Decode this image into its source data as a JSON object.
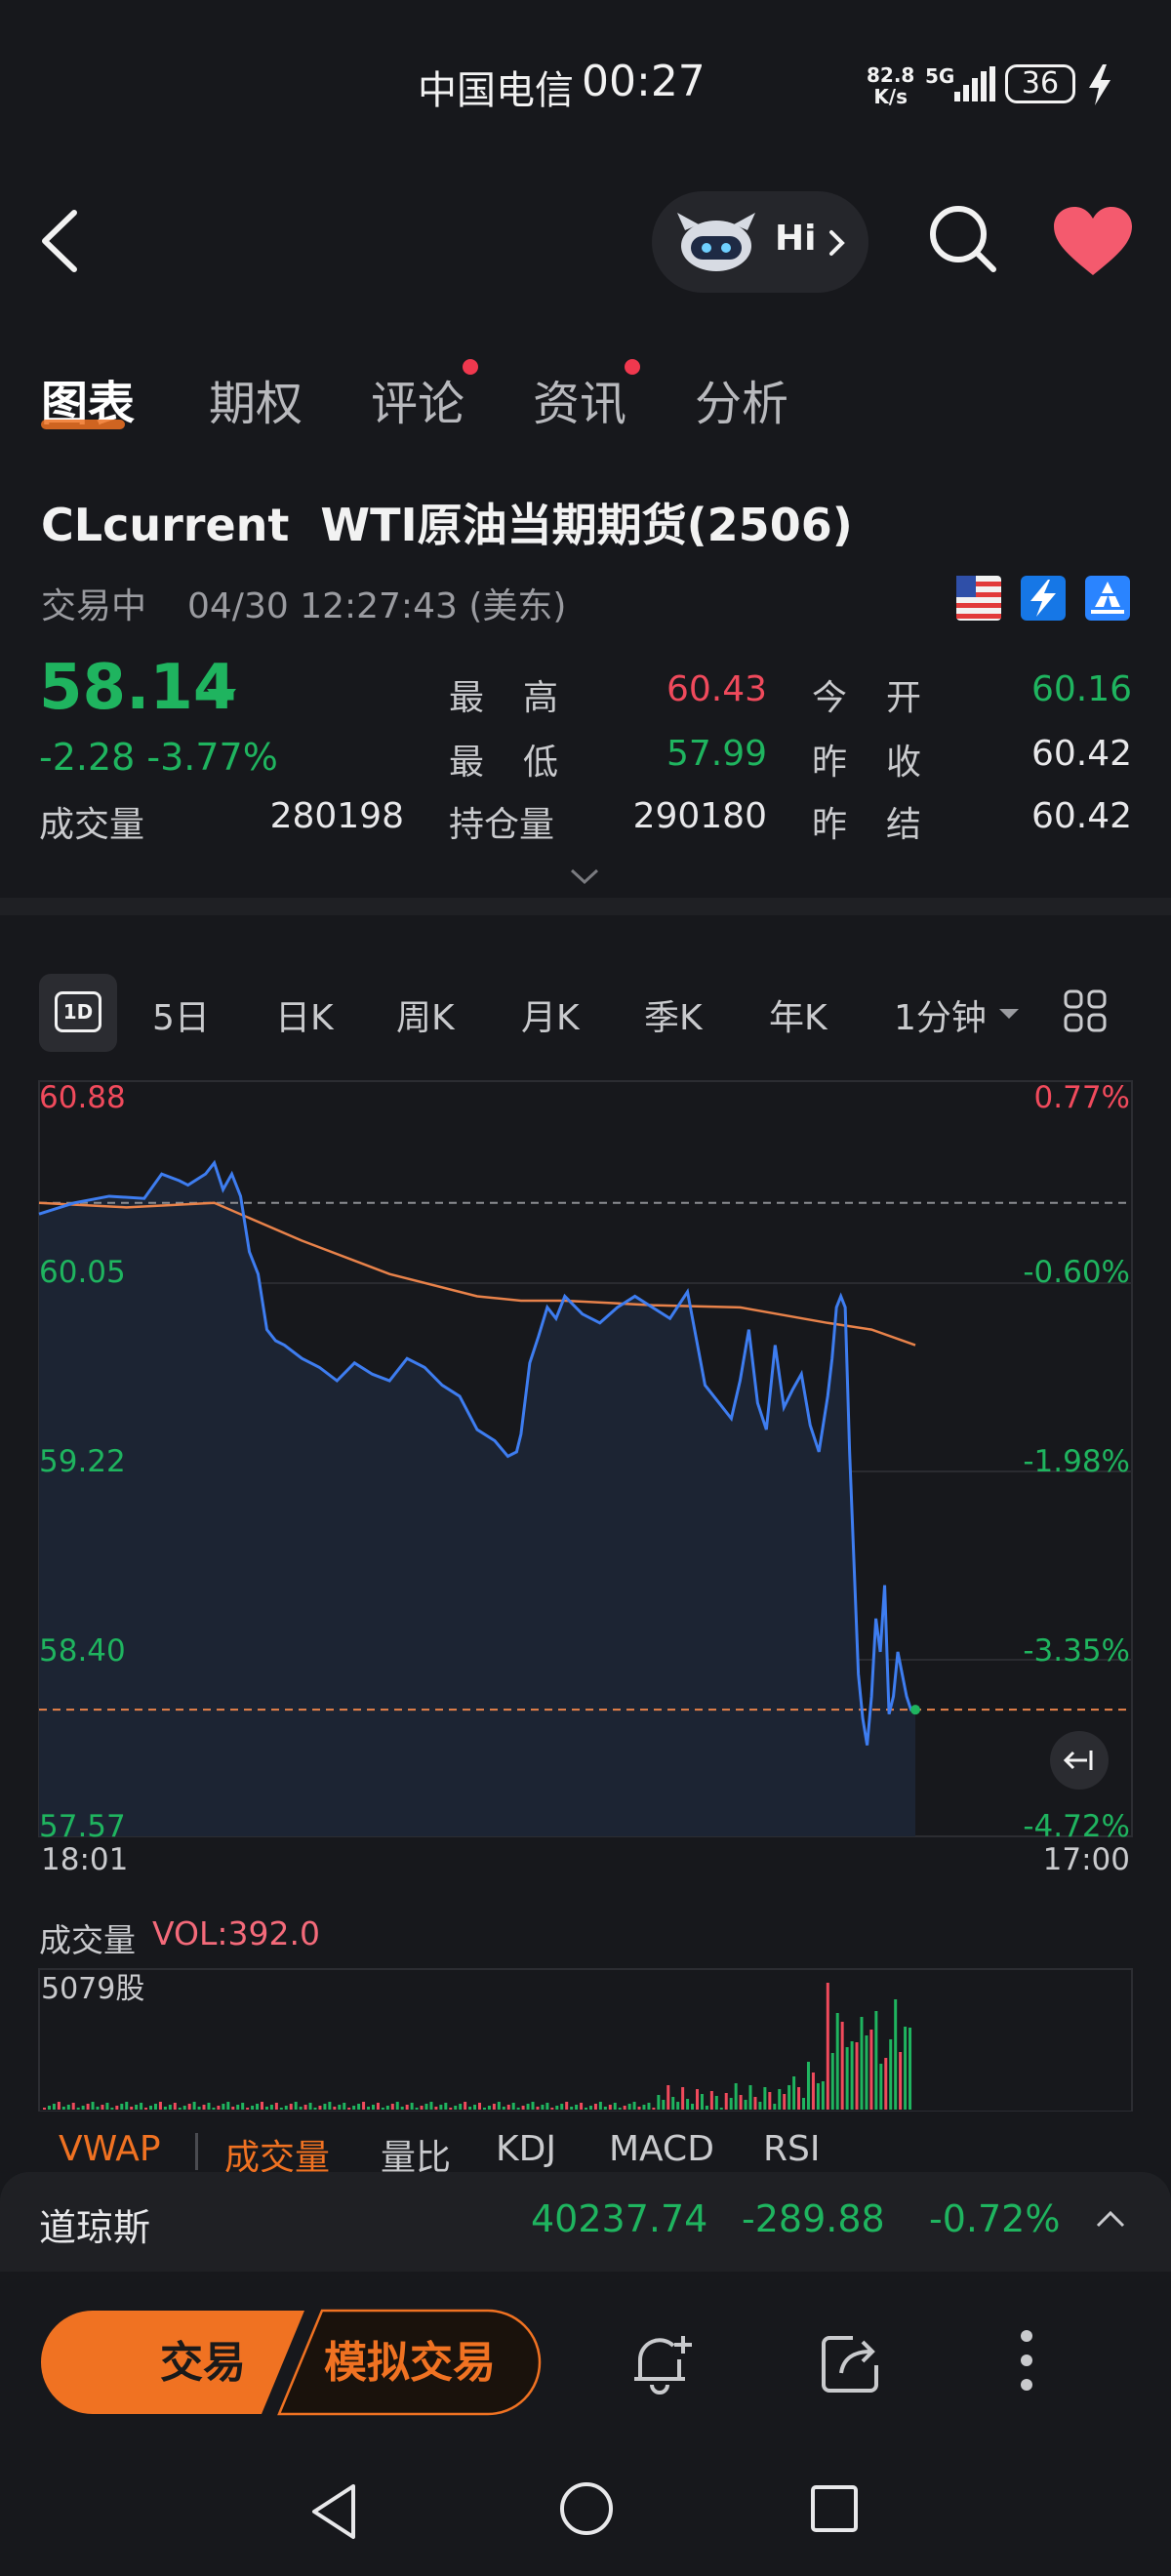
{
  "status_bar": {
    "carrier": "中国电信",
    "time": "00:27",
    "speed_value": "82.8",
    "speed_unit": "K/s",
    "network": "5G",
    "battery": "36"
  },
  "header": {
    "assistant_label": "Hi"
  },
  "tabs": [
    {
      "label": "图表",
      "active": true
    },
    {
      "label": "期权",
      "active": false
    },
    {
      "label": "评论",
      "active": false,
      "dot": true
    },
    {
      "label": "资讯",
      "active": false,
      "dot": true
    },
    {
      "label": "分析",
      "active": false
    }
  ],
  "symbol": {
    "title": "CLcurrent  WTI原油当期期货(2506)",
    "trade_status": "交易中",
    "timestamp": "04/30 12:27:43 (美东)"
  },
  "quote": {
    "last_price": "58.14",
    "change": "-2.28 -3.77%",
    "volume_label": "成交量",
    "volume": "280198",
    "high_label": "最高",
    "high": "60.43",
    "low_label": "最低",
    "low": "57.99",
    "oi_label": "持仓量",
    "open_interest": "290180",
    "open_label": "今开",
    "open": "60.16",
    "prev_close_label": "昨收",
    "prev_close": "60.42",
    "prev_settle_label": "昨结",
    "prev_settle": "60.42"
  },
  "period_tabs": {
    "active": "1D",
    "items": [
      "5日",
      "日K",
      "周K",
      "月K",
      "季K",
      "年K",
      "1分钟"
    ]
  },
  "chart_data": {
    "type": "line",
    "y_left_ticks": [
      "60.88",
      "60.05",
      "59.22",
      "58.40",
      "57.57"
    ],
    "y_right_ticks": [
      "0.77%",
      "-0.60%",
      "-1.98%",
      "-3.35%",
      "-4.72%"
    ],
    "x_start_label": "18:01",
    "x_end_label": "17:00",
    "ylim": [
      57.57,
      60.88
    ],
    "prev_settle_line": 60.42,
    "current_line": 58.14,
    "series": [
      {
        "x_fraction": [
          0,
          0.04,
          0.08,
          0.12,
          0.14,
          0.16,
          0.17,
          0.19,
          0.2,
          0.21,
          0.22,
          0.23,
          0.24,
          0.25,
          0.26,
          0.27,
          0.28,
          0.3,
          0.32,
          0.34,
          0.36,
          0.38,
          0.4,
          0.42,
          0.44,
          0.46,
          0.48,
          0.5,
          0.52,
          0.535,
          0.545,
          0.55,
          0.56,
          0.57,
          0.58,
          0.59,
          0.6,
          0.62,
          0.64,
          0.66,
          0.68,
          0.7,
          0.72,
          0.74,
          0.76,
          0.78,
          0.79,
          0.8,
          0.81,
          0.82,
          0.83,
          0.84,
          0.85,
          0.86,
          0.87,
          0.88,
          0.89,
          0.9,
          0.905,
          0.91,
          0.915,
          0.92,
          0.925,
          0.93,
          0.935,
          0.94,
          0.945,
          0.95,
          0.955,
          0.96,
          0.965,
          0.97,
          0.975,
          0.98,
          0.985,
          0.99,
          0.995,
          1.0
        ],
        "price": [
          60.37,
          60.42,
          60.45,
          60.44,
          60.55,
          60.52,
          60.5,
          60.55,
          60.6,
          60.48,
          60.55,
          60.45,
          60.2,
          60.1,
          59.85,
          59.8,
          59.78,
          59.72,
          59.68,
          59.62,
          59.7,
          59.65,
          59.62,
          59.72,
          59.68,
          59.6,
          59.55,
          59.4,
          59.35,
          59.28,
          59.3,
          59.38,
          59.7,
          59.82,
          59.95,
          59.9,
          60.0,
          59.92,
          59.88,
          59.95,
          60.0,
          59.95,
          59.9,
          60.02,
          59.6,
          59.5,
          59.45,
          59.62,
          59.85,
          59.52,
          59.4,
          59.78,
          59.5,
          59.58,
          59.65,
          59.42,
          59.3,
          59.55,
          59.72,
          59.95,
          60.0,
          59.95,
          59.3,
          58.8,
          58.3,
          58.1,
          57.98,
          58.2,
          58.55,
          58.4,
          58.7,
          58.12,
          58.2,
          58.4,
          58.3,
          58.2,
          58.14,
          58.14
        ],
        "color": "#3e7df0"
      },
      {
        "x_fraction": [
          0,
          0.1,
          0.2,
          0.3,
          0.4,
          0.5,
          0.55,
          0.6,
          0.7,
          0.8,
          0.9,
          0.95,
          1.0
        ],
        "price": [
          60.42,
          60.4,
          60.42,
          60.25,
          60.1,
          60.0,
          59.98,
          59.98,
          59.96,
          59.95,
          59.88,
          59.85,
          59.78
        ],
        "color": "#e8824a"
      }
    ]
  },
  "volume_section": {
    "title": "成交量",
    "value": "VOL:392.0",
    "max_label": "5079股",
    "bar_color_up": "#1fb45f",
    "bar_color_down": "#f04a5c"
  },
  "indicators": {
    "items": [
      "VWAP",
      "成交量",
      "量比",
      "KDJ",
      "MACD",
      "RSI"
    ],
    "active": [
      "VWAP",
      "成交量"
    ]
  },
  "index_bar": {
    "name": "道琼斯",
    "price": "40237.74",
    "change": "-289.88",
    "pct": "-0.72%"
  },
  "bottom_bar": {
    "trade_label": "交易",
    "paper_trade_label": "模拟交易"
  },
  "colors": {
    "accent": "#f07222",
    "up": "#f04a5c",
    "down": "#1fb45f",
    "background": "#17181c"
  }
}
